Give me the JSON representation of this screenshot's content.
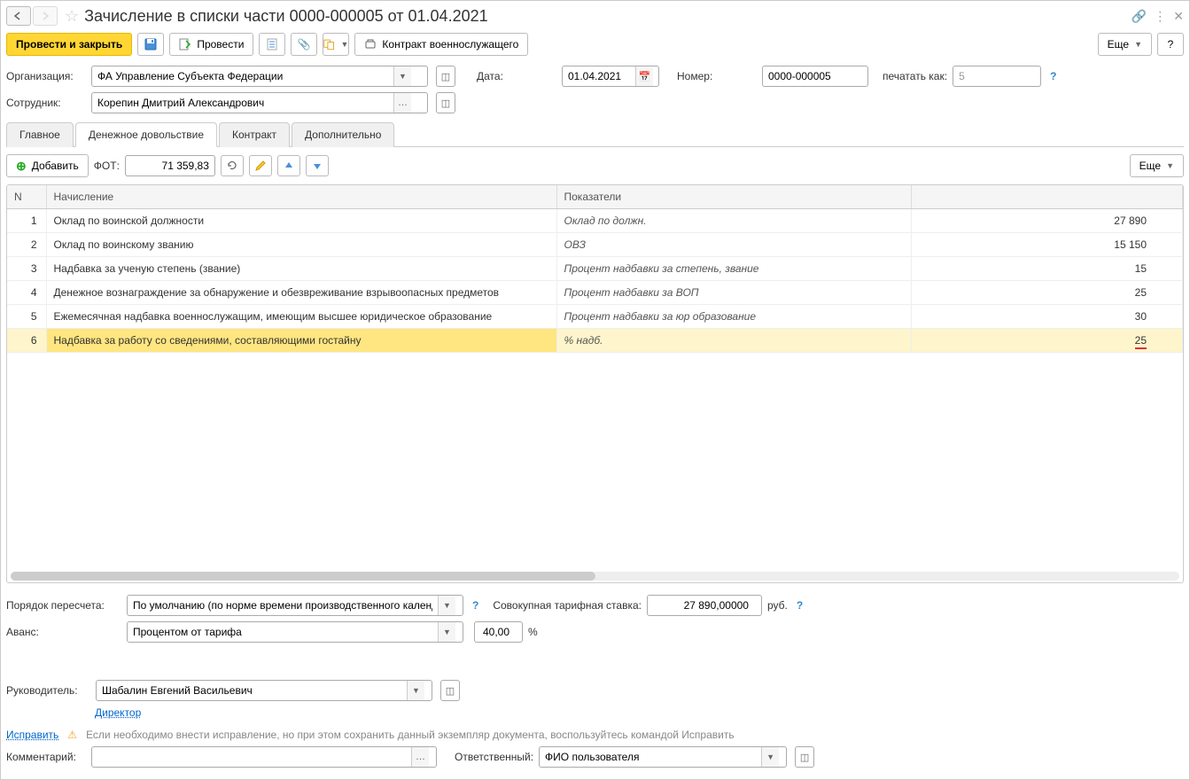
{
  "title": "Зачисление в списки части 0000-000005 от 01.04.2021",
  "toolbar": {
    "post_close": "Провести и закрыть",
    "post": "Провести",
    "contract": "Контракт военнослужащего",
    "more": "Еще"
  },
  "fields": {
    "org_label": "Организация:",
    "org_value": "ФА Управление Субъекта Федерации",
    "date_label": "Дата:",
    "date_value": "01.04.2021",
    "number_label": "Номер:",
    "number_value": "0000-000005",
    "print_as_label": "печатать как:",
    "print_as_value": "5",
    "employee_label": "Сотрудник:",
    "employee_value": "Корепин Дмитрий Александрович"
  },
  "tabs": {
    "main": "Главное",
    "allowance": "Денежное довольствие",
    "contract": "Контракт",
    "additional": "Дополнительно"
  },
  "subtoolbar": {
    "add": "Добавить",
    "fot_label": "ФОТ:",
    "fot_value": "71 359,83",
    "more": "Еще"
  },
  "table": {
    "col_n": "N",
    "col_name": "Начисление",
    "col_indicators": "Показатели",
    "rows": [
      {
        "n": "1",
        "name": "Оклад по воинской должности",
        "ind": "Оклад по должн.",
        "val": "27 890"
      },
      {
        "n": "2",
        "name": "Оклад по воинскому званию",
        "ind": "ОВЗ",
        "val": "15 150"
      },
      {
        "n": "3",
        "name": "Надбавка за ученую степень (звание)",
        "ind": "Процент надбавки за степень, звание",
        "val": "15"
      },
      {
        "n": "4",
        "name": "Денежное вознаграждение за обнаружение и обезвреживание взрывоопасных предметов",
        "ind": "Процент надбавки за ВОП",
        "val": "25"
      },
      {
        "n": "5",
        "name": "Ежемесячная надбавка военнослужащим, имеющим высшее юридическое образование",
        "ind": "Процент надбавки за юр образование",
        "val": "30"
      },
      {
        "n": "6",
        "name": "Надбавка за работу со сведениями, составляющими гостайну",
        "ind": "% надб.",
        "val": "25"
      }
    ]
  },
  "bottom": {
    "recalc_label": "Порядок пересчета:",
    "recalc_value": "По умолчанию (по норме времени производственного календаря",
    "rate_label": "Совокупная тарифная ставка:",
    "rate_value": "27 890,00000",
    "rate_unit": "руб.",
    "advance_label": "Аванс:",
    "advance_value": "Процентом от тарифа",
    "advance_pct": "40,00",
    "pct_sign": "%",
    "head_label": "Руководитель:",
    "head_value": "Шабалин Евгений Васильевич",
    "director": "Директор",
    "fix": "Исправить",
    "fix_text": "Если необходимо внести исправление, но при этом сохранить данный экземпляр документа, воспользуйтесь командой Исправить",
    "comment_label": "Комментарий:",
    "responsible_label": "Ответственный:",
    "responsible_value": "ФИО пользователя"
  },
  "help": "?"
}
